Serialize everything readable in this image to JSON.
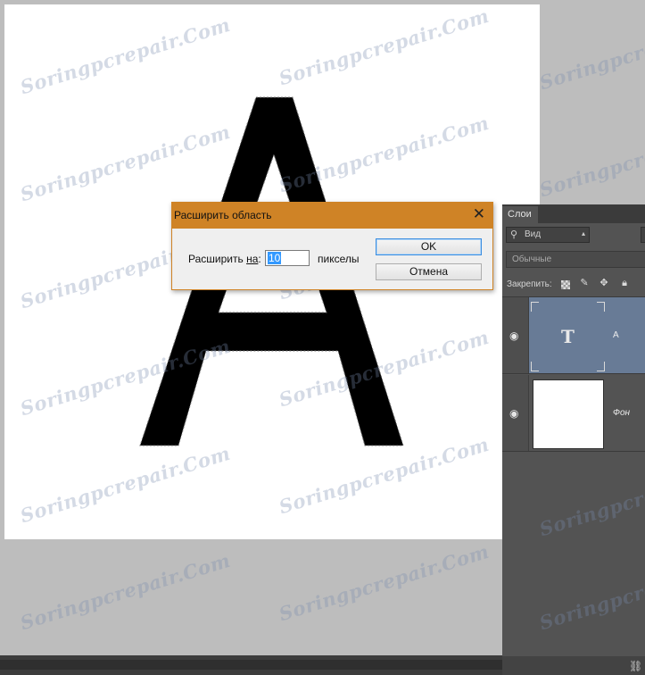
{
  "dialog": {
    "title": "Расширить область",
    "close_icon": "close-icon",
    "expand_label_prefix": "Расширить ",
    "expand_label_underlined": "на",
    "expand_label_suffix": ":",
    "expand_value": "10",
    "unit": "пикселы",
    "ok_label": "OK",
    "cancel_label": "Отмена"
  },
  "canvas": {
    "letter": "A"
  },
  "layers_panel": {
    "tab_label": "Слои",
    "filter_label": "Вид",
    "blend_mode": "Обычные",
    "lock_label": "Закрепить:",
    "icons": [
      "search-icon",
      "lock-transparency-icon",
      "brush-icon",
      "move-icon",
      "lock-icon",
      "eye-icon",
      "link-icon"
    ],
    "layers": [
      {
        "name": "A",
        "type": "text",
        "thumb_glyph": "T",
        "selected": true,
        "visible": true
      },
      {
        "name": "Фон",
        "type": "background",
        "selected": false,
        "visible": true
      }
    ]
  },
  "watermark": "Soringpcrepair.Com",
  "colors": {
    "dialog_title_bg": "#cf8326",
    "selection_highlight": "#3399ff",
    "selected_layer": "#687b96",
    "panel_bg": "#535353",
    "workspace_bg": "#bdbdbd"
  }
}
